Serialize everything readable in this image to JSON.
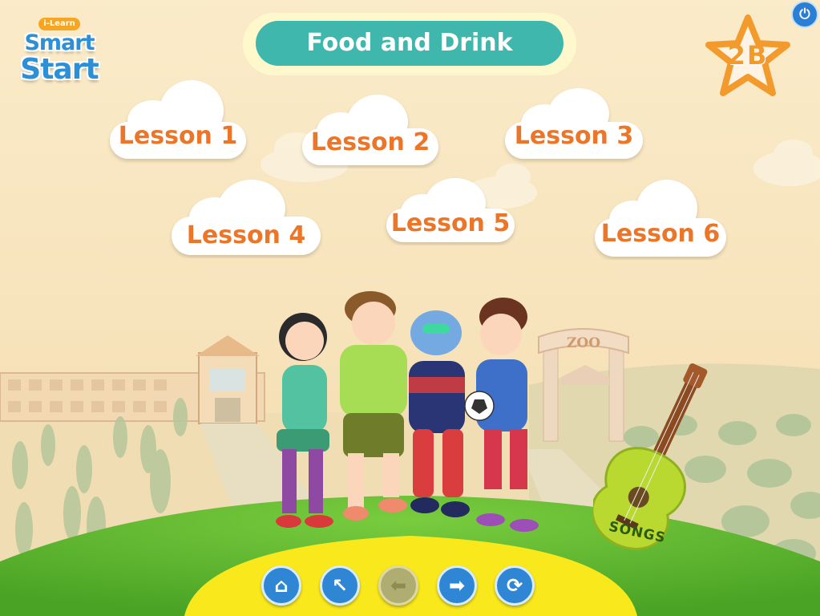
{
  "header": {
    "logo_top": "i-Learn",
    "logo_word1": "Smart",
    "logo_word2": "Start",
    "title": "Food and Drink",
    "level": "2B"
  },
  "lessons": [
    {
      "label": "Lesson 1"
    },
    {
      "label": "Lesson 2"
    },
    {
      "label": "Lesson 3"
    },
    {
      "label": "Lesson 4"
    },
    {
      "label": "Lesson 5"
    },
    {
      "label": "Lesson 6"
    }
  ],
  "scene": {
    "zoo_sign": "ZOO",
    "songs_label": "SONGS"
  },
  "nav": {
    "home_icon": "home-icon",
    "back_icon": "arrow-up-left-icon",
    "prev_icon": "arrow-left-icon",
    "next_icon": "arrow-right-icon",
    "refresh_icon": "refresh-icon",
    "prev_disabled": true
  },
  "colors": {
    "title_bg": "#3fb7ad",
    "lesson_text": "#ec7527",
    "nav_button": "#2f86d4",
    "hill": "#5cb82e",
    "stage": "#f9e81c"
  }
}
